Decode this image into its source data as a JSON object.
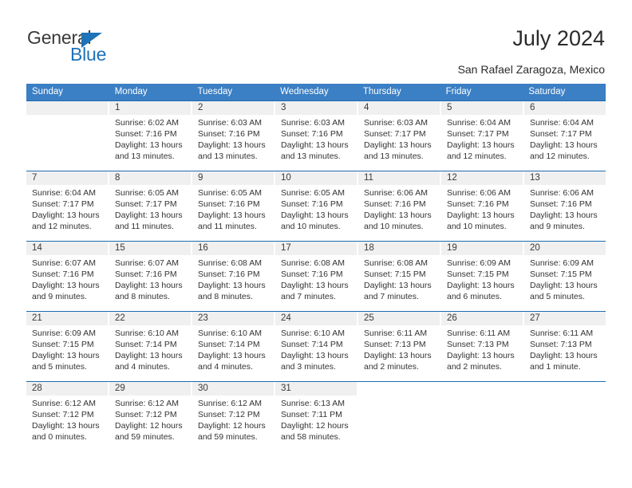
{
  "brand": {
    "name_part1": "General",
    "name_part2": "Blue",
    "accent_color": "#1d72b8"
  },
  "header": {
    "title": "July 2024",
    "subtitle": "San Rafael Zaragoza, Mexico"
  },
  "calendar": {
    "header_bg": "#3b7fc4",
    "separator_color": "#1f6cb0",
    "daynum_bg": "#f0f0f0",
    "weekdays": [
      "Sunday",
      "Monday",
      "Tuesday",
      "Wednesday",
      "Thursday",
      "Friday",
      "Saturday"
    ],
    "weeks": [
      {
        "days": [
          {
            "num": "",
            "lines": []
          },
          {
            "num": "1",
            "lines": [
              "Sunrise: 6:02 AM",
              "Sunset: 7:16 PM",
              "Daylight: 13 hours",
              "and 13 minutes."
            ]
          },
          {
            "num": "2",
            "lines": [
              "Sunrise: 6:03 AM",
              "Sunset: 7:16 PM",
              "Daylight: 13 hours",
              "and 13 minutes."
            ]
          },
          {
            "num": "3",
            "lines": [
              "Sunrise: 6:03 AM",
              "Sunset: 7:16 PM",
              "Daylight: 13 hours",
              "and 13 minutes."
            ]
          },
          {
            "num": "4",
            "lines": [
              "Sunrise: 6:03 AM",
              "Sunset: 7:17 PM",
              "Daylight: 13 hours",
              "and 13 minutes."
            ]
          },
          {
            "num": "5",
            "lines": [
              "Sunrise: 6:04 AM",
              "Sunset: 7:17 PM",
              "Daylight: 13 hours",
              "and 12 minutes."
            ]
          },
          {
            "num": "6",
            "lines": [
              "Sunrise: 6:04 AM",
              "Sunset: 7:17 PM",
              "Daylight: 13 hours",
              "and 12 minutes."
            ]
          }
        ]
      },
      {
        "days": [
          {
            "num": "7",
            "lines": [
              "Sunrise: 6:04 AM",
              "Sunset: 7:17 PM",
              "Daylight: 13 hours",
              "and 12 minutes."
            ]
          },
          {
            "num": "8",
            "lines": [
              "Sunrise: 6:05 AM",
              "Sunset: 7:17 PM",
              "Daylight: 13 hours",
              "and 11 minutes."
            ]
          },
          {
            "num": "9",
            "lines": [
              "Sunrise: 6:05 AM",
              "Sunset: 7:16 PM",
              "Daylight: 13 hours",
              "and 11 minutes."
            ]
          },
          {
            "num": "10",
            "lines": [
              "Sunrise: 6:05 AM",
              "Sunset: 7:16 PM",
              "Daylight: 13 hours",
              "and 10 minutes."
            ]
          },
          {
            "num": "11",
            "lines": [
              "Sunrise: 6:06 AM",
              "Sunset: 7:16 PM",
              "Daylight: 13 hours",
              "and 10 minutes."
            ]
          },
          {
            "num": "12",
            "lines": [
              "Sunrise: 6:06 AM",
              "Sunset: 7:16 PM",
              "Daylight: 13 hours",
              "and 10 minutes."
            ]
          },
          {
            "num": "13",
            "lines": [
              "Sunrise: 6:06 AM",
              "Sunset: 7:16 PM",
              "Daylight: 13 hours",
              "and 9 minutes."
            ]
          }
        ]
      },
      {
        "days": [
          {
            "num": "14",
            "lines": [
              "Sunrise: 6:07 AM",
              "Sunset: 7:16 PM",
              "Daylight: 13 hours",
              "and 9 minutes."
            ]
          },
          {
            "num": "15",
            "lines": [
              "Sunrise: 6:07 AM",
              "Sunset: 7:16 PM",
              "Daylight: 13 hours",
              "and 8 minutes."
            ]
          },
          {
            "num": "16",
            "lines": [
              "Sunrise: 6:08 AM",
              "Sunset: 7:16 PM",
              "Daylight: 13 hours",
              "and 8 minutes."
            ]
          },
          {
            "num": "17",
            "lines": [
              "Sunrise: 6:08 AM",
              "Sunset: 7:16 PM",
              "Daylight: 13 hours",
              "and 7 minutes."
            ]
          },
          {
            "num": "18",
            "lines": [
              "Sunrise: 6:08 AM",
              "Sunset: 7:15 PM",
              "Daylight: 13 hours",
              "and 7 minutes."
            ]
          },
          {
            "num": "19",
            "lines": [
              "Sunrise: 6:09 AM",
              "Sunset: 7:15 PM",
              "Daylight: 13 hours",
              "and 6 minutes."
            ]
          },
          {
            "num": "20",
            "lines": [
              "Sunrise: 6:09 AM",
              "Sunset: 7:15 PM",
              "Daylight: 13 hours",
              "and 5 minutes."
            ]
          }
        ]
      },
      {
        "days": [
          {
            "num": "21",
            "lines": [
              "Sunrise: 6:09 AM",
              "Sunset: 7:15 PM",
              "Daylight: 13 hours",
              "and 5 minutes."
            ]
          },
          {
            "num": "22",
            "lines": [
              "Sunrise: 6:10 AM",
              "Sunset: 7:14 PM",
              "Daylight: 13 hours",
              "and 4 minutes."
            ]
          },
          {
            "num": "23",
            "lines": [
              "Sunrise: 6:10 AM",
              "Sunset: 7:14 PM",
              "Daylight: 13 hours",
              "and 4 minutes."
            ]
          },
          {
            "num": "24",
            "lines": [
              "Sunrise: 6:10 AM",
              "Sunset: 7:14 PM",
              "Daylight: 13 hours",
              "and 3 minutes."
            ]
          },
          {
            "num": "25",
            "lines": [
              "Sunrise: 6:11 AM",
              "Sunset: 7:13 PM",
              "Daylight: 13 hours",
              "and 2 minutes."
            ]
          },
          {
            "num": "26",
            "lines": [
              "Sunrise: 6:11 AM",
              "Sunset: 7:13 PM",
              "Daylight: 13 hours",
              "and 2 minutes."
            ]
          },
          {
            "num": "27",
            "lines": [
              "Sunrise: 6:11 AM",
              "Sunset: 7:13 PM",
              "Daylight: 13 hours",
              "and 1 minute."
            ]
          }
        ]
      },
      {
        "days": [
          {
            "num": "28",
            "lines": [
              "Sunrise: 6:12 AM",
              "Sunset: 7:12 PM",
              "Daylight: 13 hours",
              "and 0 minutes."
            ]
          },
          {
            "num": "29",
            "lines": [
              "Sunrise: 6:12 AM",
              "Sunset: 7:12 PM",
              "Daylight: 12 hours",
              "and 59 minutes."
            ]
          },
          {
            "num": "30",
            "lines": [
              "Sunrise: 6:12 AM",
              "Sunset: 7:12 PM",
              "Daylight: 12 hours",
              "and 59 minutes."
            ]
          },
          {
            "num": "31",
            "lines": [
              "Sunrise: 6:13 AM",
              "Sunset: 7:11 PM",
              "Daylight: 12 hours",
              "and 58 minutes."
            ]
          },
          {
            "num": "",
            "lines": []
          },
          {
            "num": "",
            "lines": []
          },
          {
            "num": "",
            "lines": []
          }
        ]
      }
    ]
  }
}
